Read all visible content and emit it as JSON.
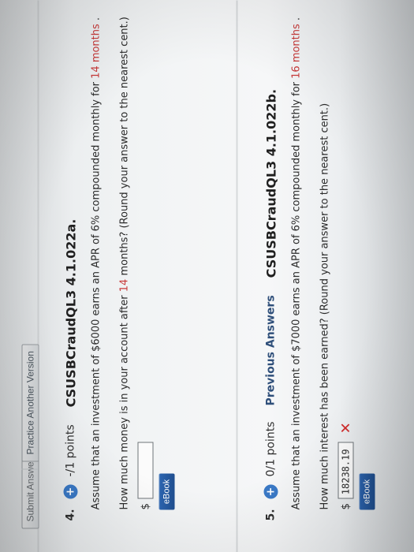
{
  "toolbar": {
    "submit_answer_label": "Submit Answer",
    "practice_another_version_label": "Practice Another Version"
  },
  "question4": {
    "number": "4.",
    "points": "-/1 points",
    "code": "CSUSBCraudQL3 4.1.022a.",
    "prompt_parts": [
      "Assume that an investment of $6000 earns an APR of 6% compounded monthly for ",
      "14 months",
      "."
    ],
    "question_parts": [
      "How much money is in your account after ",
      "14",
      " months? (Round your answer to the nearest cent.)"
    ],
    "currency_symbol": "$",
    "answer_value": "",
    "ebook_label": "eBook"
  },
  "question5": {
    "number": "5.",
    "points": "0/1 points",
    "previous_answers_label": "Previous Answers",
    "code": "CSUSBCraudQL3 4.1.022b.",
    "prompt_parts": [
      "Assume that an investment of $7000 earns an APR of 6% compounded monthly for ",
      "16 months",
      "."
    ],
    "question_text": "How much interest has been earned? (Round your answer to the nearest cent.)",
    "currency_symbol": "$",
    "answer_value": "18238.19",
    "incorrect_mark": "✕",
    "ebook_label": "eBook"
  },
  "colors": {
    "accent_blue": "#3a79c6",
    "emphasis_red": "#c83a3a",
    "incorrect_red": "#d12b2b"
  },
  "icons": {
    "add_points": "plus-circle-icon",
    "incorrect": "x-mark-icon"
  }
}
